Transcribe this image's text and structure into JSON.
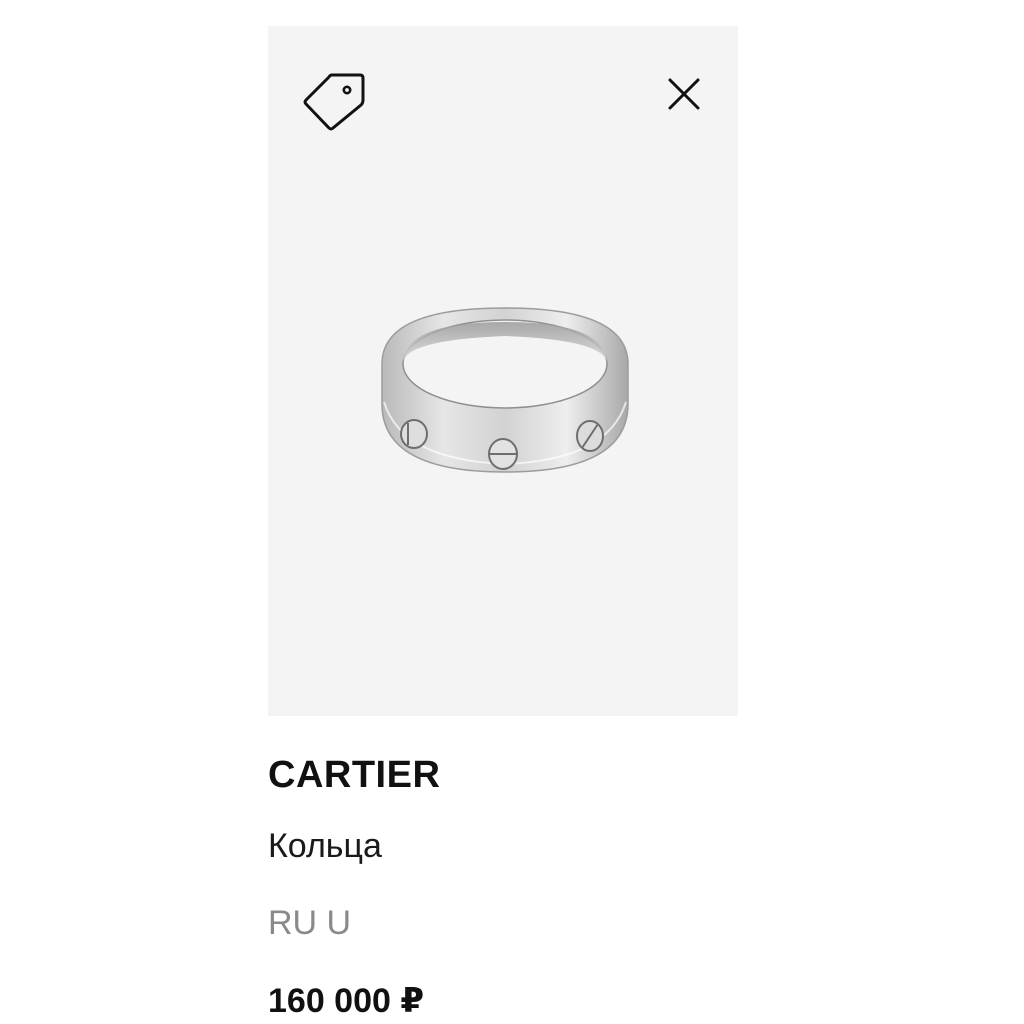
{
  "product": {
    "brand": "CARTIER",
    "category": "Кольца",
    "size": "RU U",
    "price": "160 000 ₽",
    "image_alt": "silver-ring-with-screw-motifs"
  },
  "icons": {
    "tag": "price-tag-icon",
    "close": "close-icon"
  },
  "colors": {
    "card_background": "#f4f4f4",
    "text_primary": "#111111",
    "text_secondary": "#8a8a8a"
  }
}
